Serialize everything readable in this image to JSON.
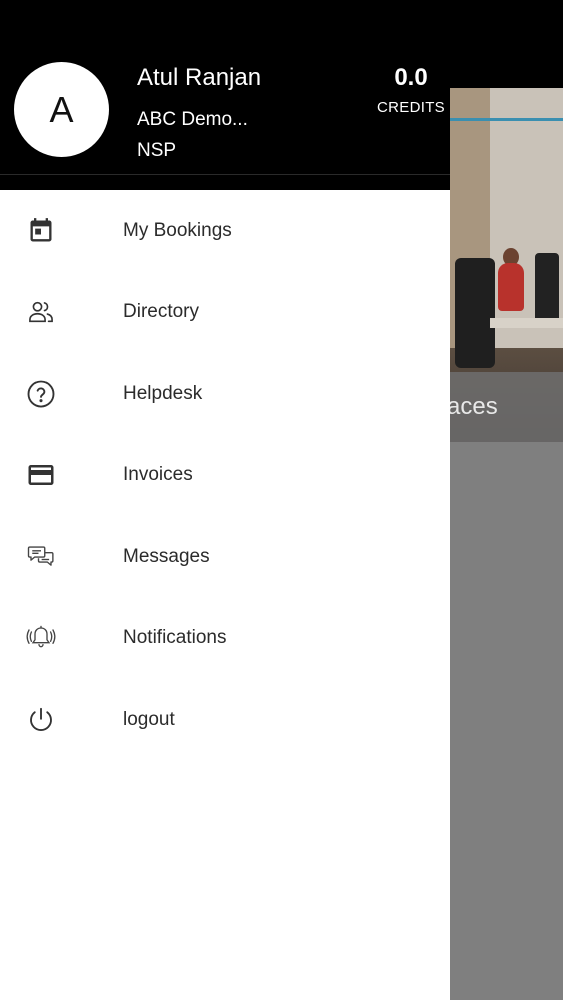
{
  "background": {
    "hero_caption": "aces"
  },
  "drawer": {
    "avatar_initial": "A",
    "user_name": "Atul Ranjan",
    "company": "ABC Demo...",
    "location": "NSP",
    "credits_value": "0.0",
    "credits_label": "CREDITS",
    "menu": [
      {
        "label": "My Bookings",
        "icon": "calendar-icon"
      },
      {
        "label": "Directory",
        "icon": "people-icon"
      },
      {
        "label": "Helpdesk",
        "icon": "help-circle-icon"
      },
      {
        "label": "Invoices",
        "icon": "credit-card-icon"
      },
      {
        "label": "Messages",
        "icon": "chat-bubbles-icon"
      },
      {
        "label": "Notifications",
        "icon": "bell-ringing-icon"
      },
      {
        "label": "logout",
        "icon": "power-icon"
      }
    ]
  }
}
